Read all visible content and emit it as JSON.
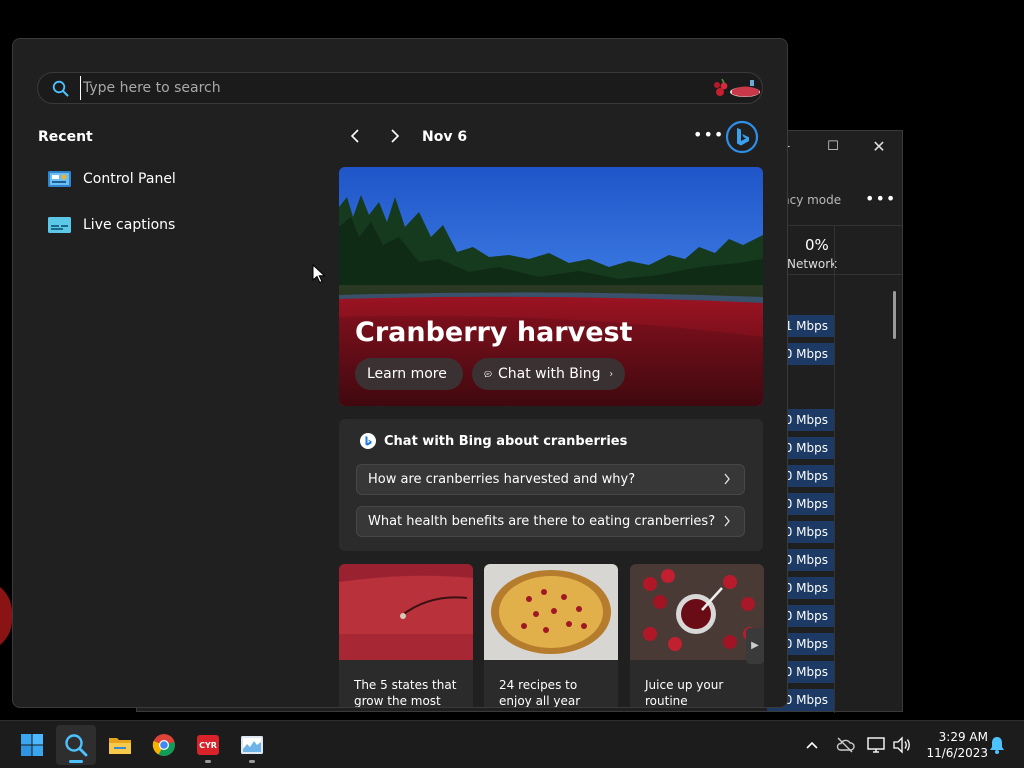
{
  "search": {
    "placeholder": "Type here to search"
  },
  "recent": {
    "title": "Recent",
    "items": [
      {
        "label": "Control Panel",
        "icon": "control-panel-icon"
      },
      {
        "label": "Live captions",
        "icon": "live-captions-icon"
      }
    ]
  },
  "feed": {
    "date": "Nov 6",
    "hero": {
      "title": "Cranberry harvest",
      "learn_more": "Learn more",
      "chat_with_bing": "Chat with Bing"
    },
    "chat": {
      "title": "Chat with Bing about cranberries",
      "questions": [
        "How are cranberries harvested and why?",
        "What health benefits are there to eating cranberries?"
      ]
    },
    "tiles": [
      {
        "text": "The 5 states that grow the most"
      },
      {
        "text": "24 recipes to enjoy all year"
      },
      {
        "text": "Juice up your routine"
      }
    ]
  },
  "background_window": {
    "efficiency_label": "ncy mode",
    "network_percent": "0%",
    "network_label": "Network",
    "rows": [
      "1 Mbps",
      "0 Mbps",
      "0 Mbps",
      "0 Mbps",
      "0 Mbps",
      "0 Mbps",
      "0 Mbps",
      "0 Mbps",
      "0 Mbps",
      "0 Mbps",
      "0 Mbps",
      "0 Mbps",
      "0 Mbps"
    ]
  },
  "taskbar": {
    "apps": [
      "windows-start-icon",
      "search-icon",
      "file-explorer-icon",
      "chrome-icon",
      "cyberlink-icon",
      "task-manager-icon"
    ],
    "time": "3:29 AM",
    "date": "11/6/2023"
  },
  "colors": {
    "accent": "#4cc2ff",
    "cranberry": "#b01e2a",
    "background": "#202020"
  }
}
